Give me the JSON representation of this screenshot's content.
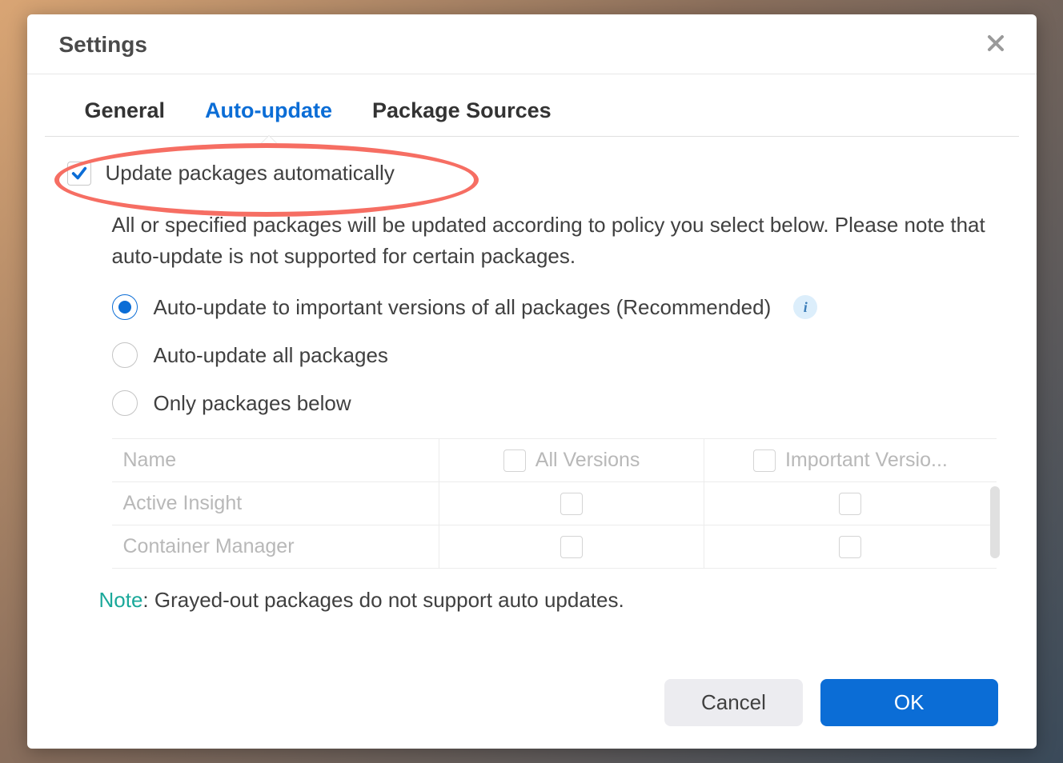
{
  "dialog": {
    "title": "Settings"
  },
  "tabs": {
    "general": "General",
    "autoupdate": "Auto-update",
    "sources": "Package Sources"
  },
  "checkbox": {
    "label": "Update packages automatically"
  },
  "description": "All or specified packages will be updated according to policy you select below. Please note that auto-update is not supported for certain packages.",
  "radios": {
    "important": "Auto-update to important versions of all packages (Recommended)",
    "all": "Auto-update all packages",
    "below": "Only packages below"
  },
  "table": {
    "headers": {
      "name": "Name",
      "all_versions": "All Versions",
      "important_versions": "Important Versio..."
    },
    "rows": [
      {
        "name": "Active Insight"
      },
      {
        "name": "Container Manager"
      }
    ]
  },
  "note": {
    "label": "Note",
    "text": ": Grayed-out packages do not support auto updates."
  },
  "buttons": {
    "cancel": "Cancel",
    "ok": "OK"
  },
  "info_icon_char": "i"
}
